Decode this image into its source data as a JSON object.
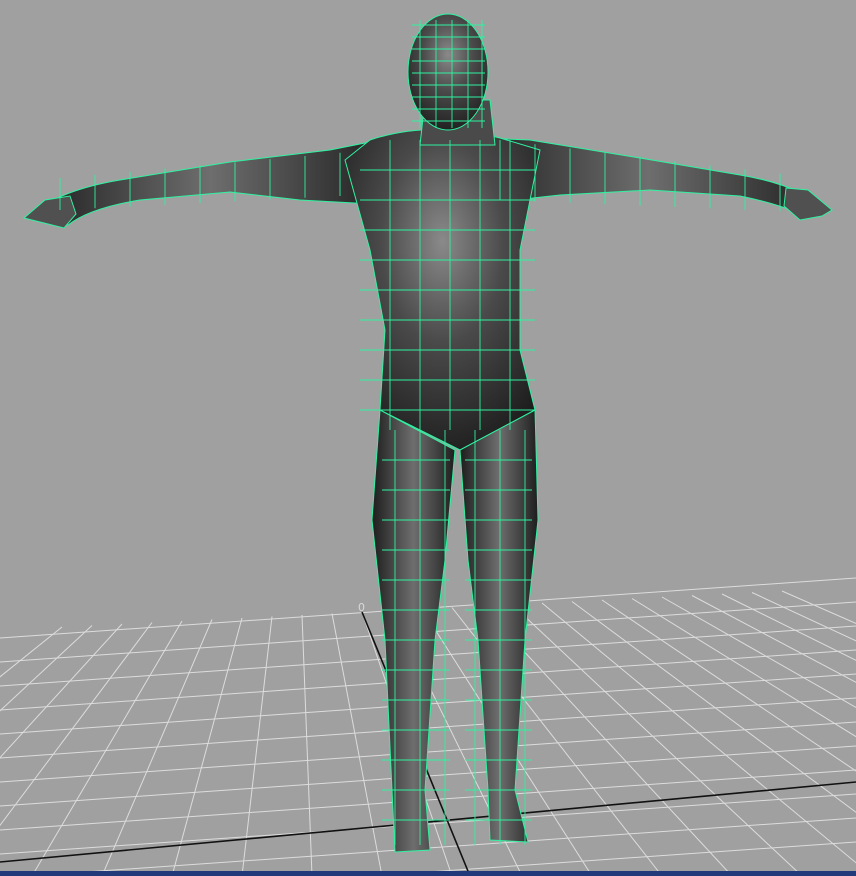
{
  "viewport": {
    "name": "perspective-viewport",
    "background": "#a0a0a0",
    "grid_color": "#dcdcdc",
    "axis_color": "#111111",
    "wireframe_color": "#2ff2a0",
    "mesh_shade": "#3a3a3a",
    "grid_origin_label": "0"
  }
}
